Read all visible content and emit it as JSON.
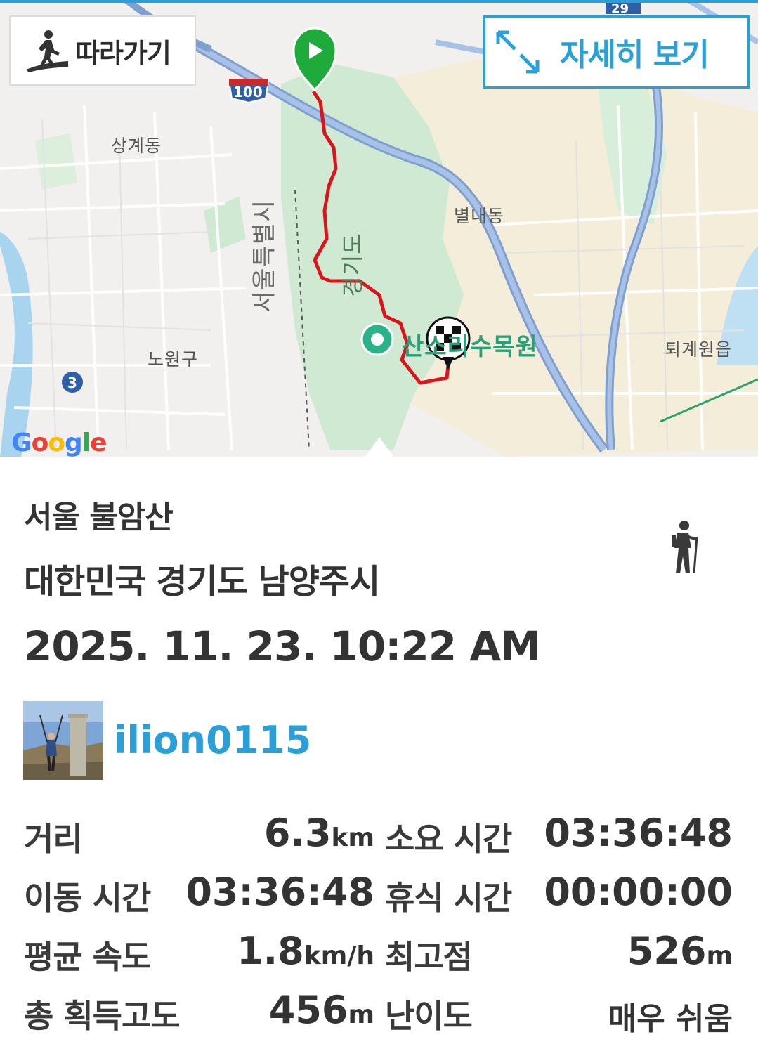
{
  "map": {
    "follow_label": "따라가기",
    "detail_label": "자세히 보기",
    "labels": {
      "sanggye": "상계동",
      "seoul": "서울특별시",
      "gyeonggi": "경기도",
      "byeollae": "별내동",
      "nowon": "노원구",
      "toegyewon": "퇴계원읍",
      "arboretum": "산소리수목원",
      "route_badge": "100",
      "route_badge_top": "29",
      "line_badge": "3"
    },
    "provider": "Google",
    "route_color": "#d9141b",
    "start_marker_color": "#1faa3c",
    "accent_color": "#2a9fd8"
  },
  "activity": {
    "title": "서울 불암산",
    "location": "대한민국 경기도 남양주시",
    "datetime": "2025. 11. 23. 10:22 AM",
    "activity_icon": "hiker-icon",
    "username": "ilion0115"
  },
  "stats": [
    {
      "label": "거리",
      "value": "6.3",
      "unit": "km",
      "label2": "소요 시간",
      "value2": "03:36:48",
      "unit2": ""
    },
    {
      "label": "이동 시간",
      "value": "03:36:48",
      "unit": "",
      "label2": "휴식 시간",
      "value2": "00:00:00",
      "unit2": ""
    },
    {
      "label": "평균 속도",
      "value": "1.8",
      "unit": "km/h",
      "label2": "최고점",
      "value2": "526",
      "unit2": "m"
    },
    {
      "label": "총 획득고도",
      "value": "456",
      "unit": "m",
      "label2": "난이도",
      "value2": "매우 쉬움",
      "unit2": ""
    }
  ]
}
